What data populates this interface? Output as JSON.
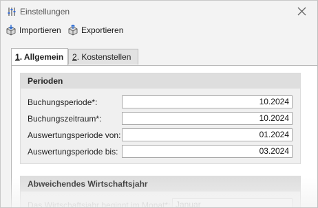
{
  "window": {
    "title": "Einstellungen"
  },
  "toolbar": {
    "import_label": "Importieren",
    "export_label": "Exportieren"
  },
  "tabs": [
    {
      "hotkey": "1",
      "label": ". Allgemein",
      "active": true
    },
    {
      "hotkey": "2",
      "label": ". Kostenstellen",
      "active": false
    }
  ],
  "perioden": {
    "header": "Perioden",
    "rows": [
      {
        "label": "Buchungsperiode*:",
        "value": "10.2024"
      },
      {
        "label": "Buchungszeitraum*:",
        "value": "10.2024"
      },
      {
        "label": "Auswertungsperiode von:",
        "value": "01.2024"
      },
      {
        "label": "Auswertungsperiode bis:",
        "value": "03.2024"
      }
    ]
  },
  "wirtschaftsjahr": {
    "header": "Abweichendes Wirtschaftsjahr",
    "row_label": "Das Wirtschaftsjahr beginnt im Monat*:",
    "row_value": "Januar"
  },
  "colors": {
    "background": "#f3f3f3",
    "group_header": "#dedede",
    "border": "#b9b9b9"
  }
}
